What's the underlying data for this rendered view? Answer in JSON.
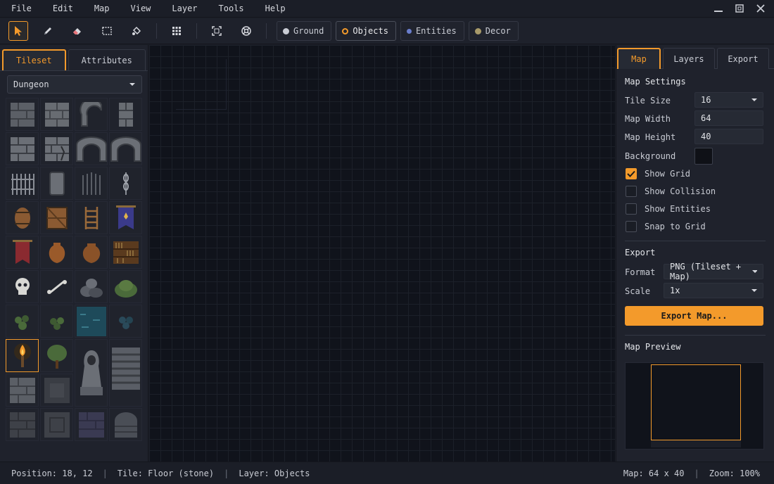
{
  "menu": [
    "File",
    "Edit",
    "Map",
    "View",
    "Layer",
    "Tools",
    "Help"
  ],
  "toolbar": {
    "layers": [
      {
        "label": "Ground",
        "color": "#c9ccd4",
        "style": "solid"
      },
      {
        "label": "Objects",
        "color": "#f39a2b",
        "style": "ring"
      },
      {
        "label": "Entities",
        "color": "#6a7ecc",
        "style": "solid"
      },
      {
        "label": "Decor",
        "color": "#a89a6a",
        "style": "solid"
      }
    ]
  },
  "left_panel": {
    "tabs": [
      "Tileset",
      "Attributes"
    ],
    "tileset": "Dungeon"
  },
  "right_panel": {
    "tabs": [
      "Map",
      "Layers",
      "Export"
    ],
    "map_settings": {
      "title": "Map Settings",
      "tile_size_label": "Tile Size",
      "tile_size": "16",
      "map_width_label": "Map Width",
      "map_width": "64",
      "map_height_label": "Map Height",
      "map_height": "40",
      "background_label": "Background",
      "background_color": "#0f1117",
      "checkboxes": [
        {
          "label": "Show Grid",
          "checked": true
        },
        {
          "label": "Show Collision",
          "checked": false
        },
        {
          "label": "Show Entities",
          "checked": false
        },
        {
          "label": "Snap to Grid",
          "checked": false
        }
      ]
    },
    "export": {
      "title": "Export",
      "format_label": "Format",
      "format": "PNG (Tileset + Map)",
      "scale_label": "Scale",
      "scale": "1x",
      "button": "Export Map..."
    },
    "preview_title": "Map Preview"
  },
  "status": {
    "position": "Position: 18, 12",
    "tile": "Tile: Floor (stone)",
    "layer": "Layer: Objects",
    "map": "Map: 64 x 40",
    "zoom": "Zoom: 100%"
  },
  "colors": {
    "accent": "#f39a2b",
    "background": "#1b1e27",
    "canvas": "#10131b"
  }
}
